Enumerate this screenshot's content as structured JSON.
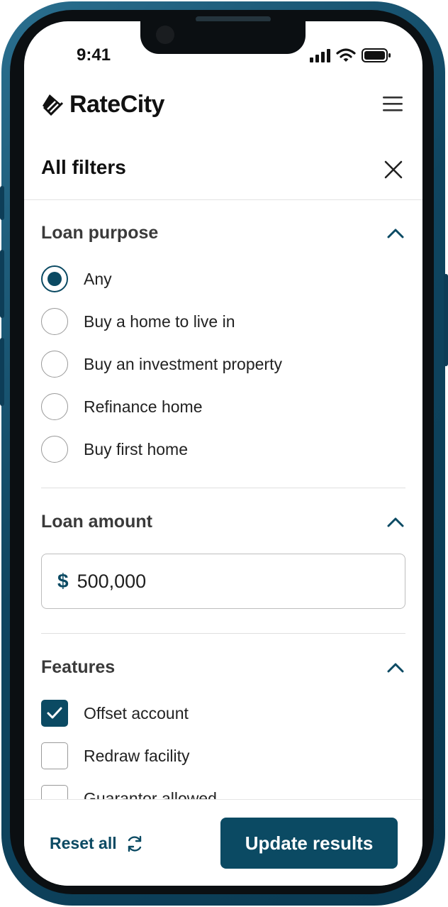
{
  "status_bar": {
    "time": "9:41"
  },
  "header": {
    "brand": "RateCity",
    "menu_icon": "hamburger-icon"
  },
  "filters": {
    "title": "All filters",
    "close_icon": "close-icon"
  },
  "loan_purpose": {
    "title": "Loan purpose",
    "expanded": true,
    "selected": "Any",
    "options": [
      {
        "label": "Any",
        "selected": true
      },
      {
        "label": "Buy a home to live in",
        "selected": false
      },
      {
        "label": "Buy an investment property",
        "selected": false
      },
      {
        "label": "Refinance home",
        "selected": false
      },
      {
        "label": "Buy first home",
        "selected": false
      }
    ]
  },
  "loan_amount": {
    "title": "Loan amount",
    "expanded": true,
    "currency": "$",
    "value": "500,000"
  },
  "features": {
    "title": "Features",
    "expanded": true,
    "options": [
      {
        "label": "Offset account",
        "checked": true
      },
      {
        "label": "Redraw facility",
        "checked": false
      },
      {
        "label": "Guarantor allowed",
        "checked": false
      }
    ]
  },
  "footer": {
    "reset_label": "Reset all",
    "reset_icon": "refresh-icon",
    "update_label": "Update results"
  },
  "colors": {
    "brand": "#0b4a63",
    "frame": "#0f4560"
  }
}
